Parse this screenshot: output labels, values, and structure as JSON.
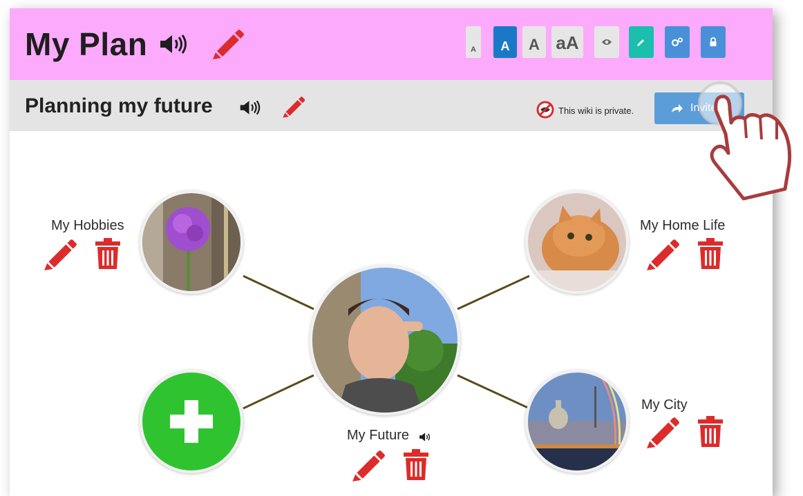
{
  "header": {
    "title": "My Plan",
    "font_sizes": [
      "A",
      "A",
      "A",
      "aA"
    ],
    "icons": [
      "speaker-icon",
      "pencil-icon",
      "eye-icon",
      "edit-icon",
      "settings-icon",
      "lock-icon"
    ]
  },
  "wiki": {
    "title": "Planning my future",
    "privacy_text": "This wiki is private.",
    "invite_label": "Invite"
  },
  "map": {
    "center": {
      "label": "My Future"
    },
    "nodes": [
      {
        "label": "My Hobbies"
      },
      {
        "label": "My Home Life"
      },
      {
        "label": "My City"
      }
    ],
    "add_icon": "plus-icon"
  },
  "colors": {
    "header_bg": "#fcaafc",
    "subheader_bg": "#e4e4e4",
    "accent_red": "#dd2b2b",
    "active_blue": "#1a79c7",
    "invite_blue": "#5b9dd9",
    "teal": "#1bbfae",
    "add_green": "#2fc42f",
    "link_line": "#5a4a1a"
  }
}
